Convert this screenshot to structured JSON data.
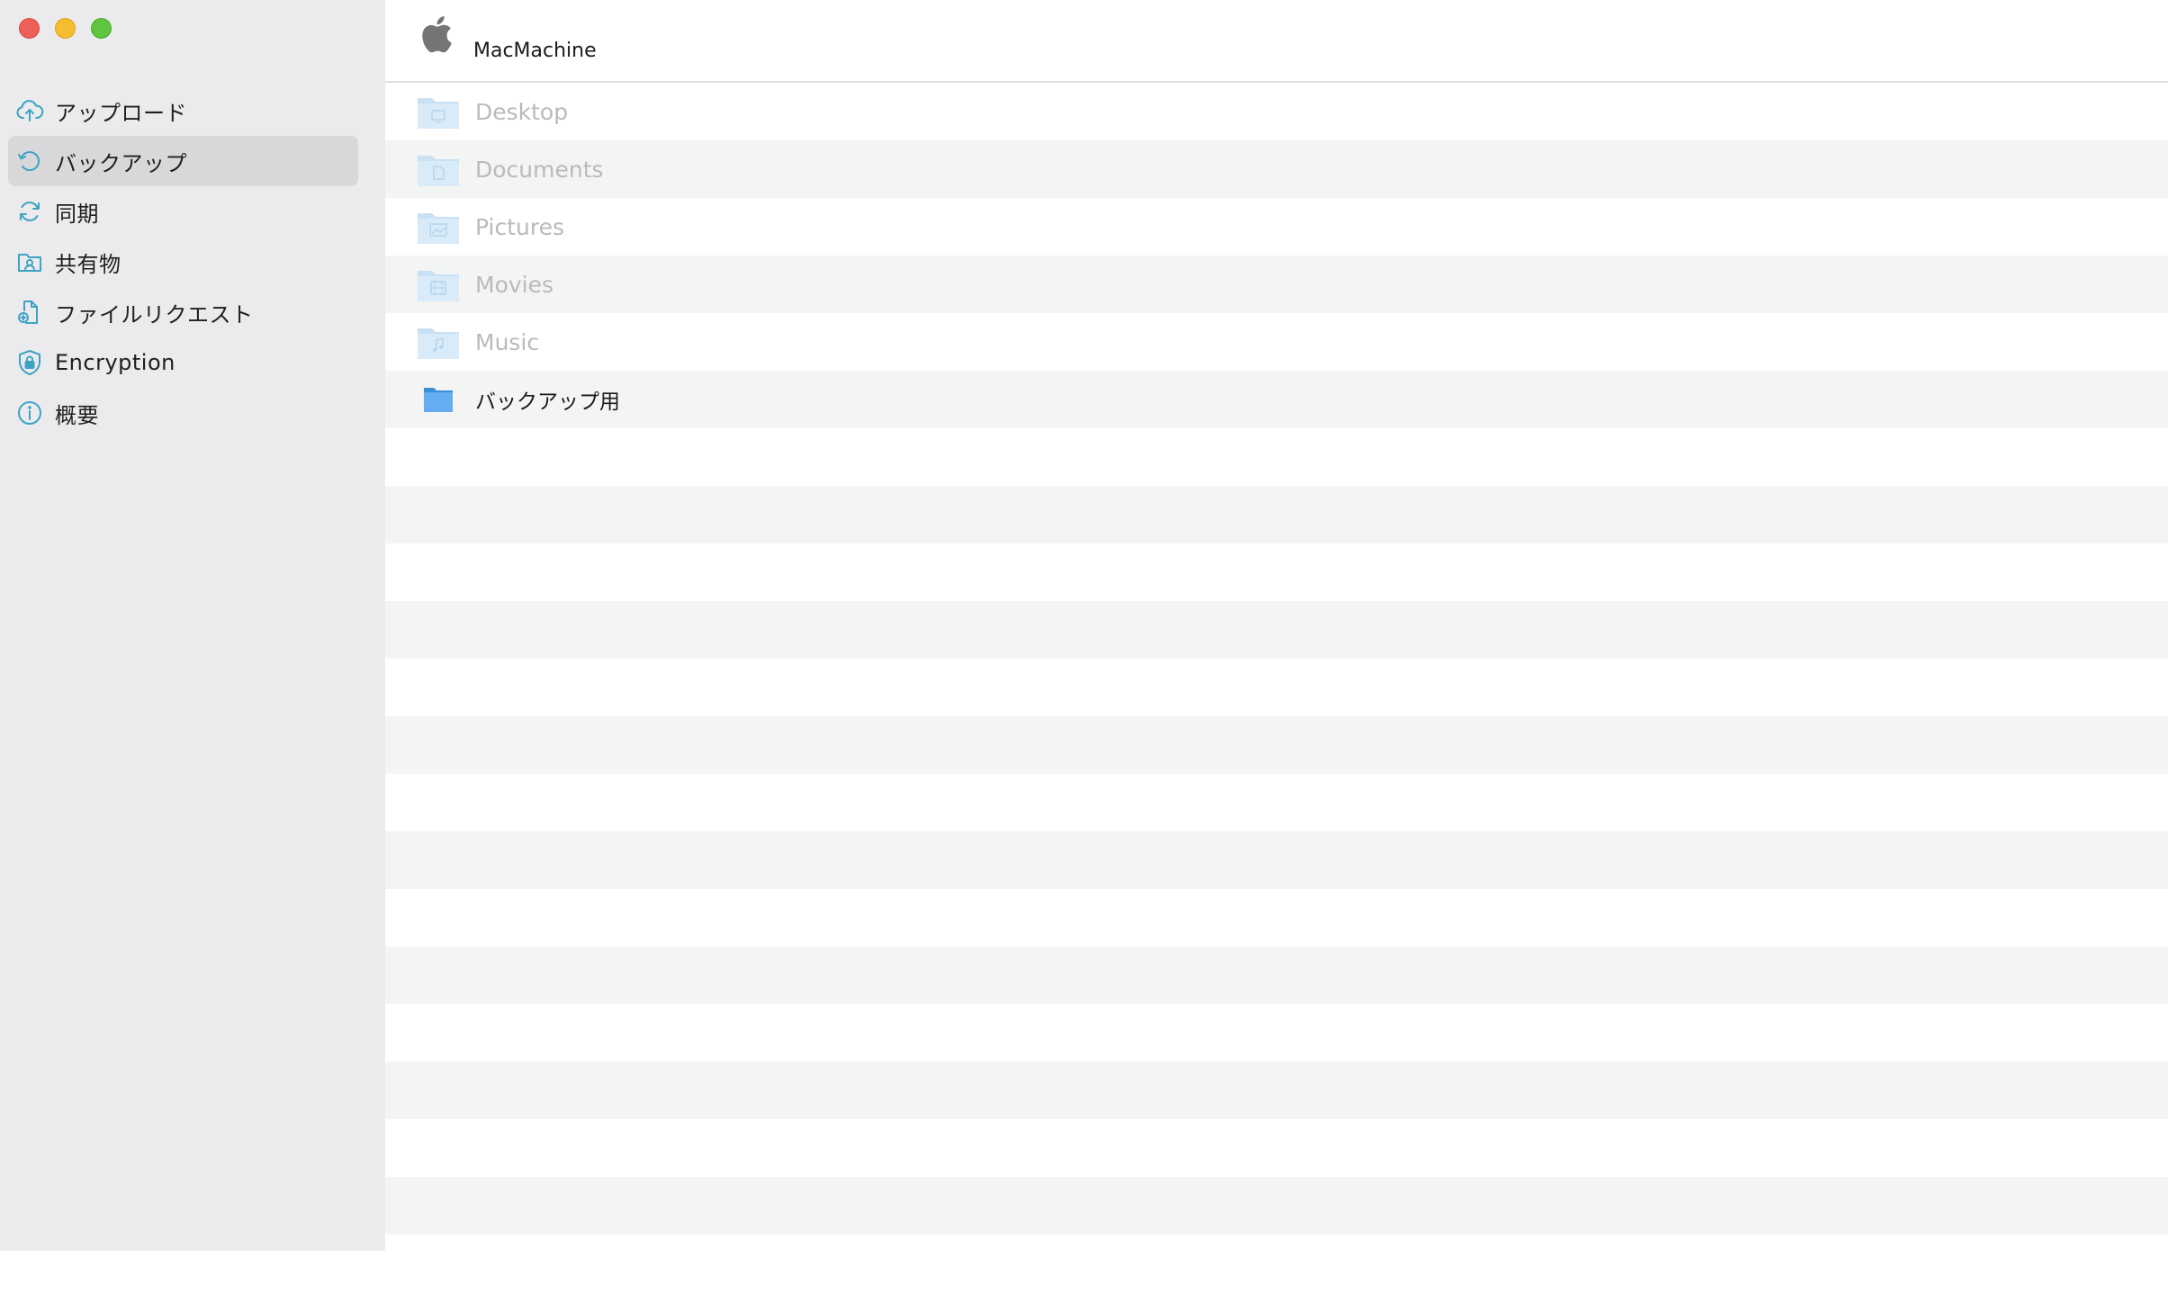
{
  "header": {
    "title": "MacMachine",
    "icon": "apple-logo-icon"
  },
  "sidebar": {
    "items": [
      {
        "label": "アップロード",
        "icon": "cloud-upload-icon",
        "selected": false
      },
      {
        "label": "バックアップ",
        "icon": "backup-history-icon",
        "selected": true
      },
      {
        "label": "同期",
        "icon": "sync-icon",
        "selected": false
      },
      {
        "label": "共有物",
        "icon": "shared-folder-icon",
        "selected": false
      },
      {
        "label": "ファイルリクエスト",
        "icon": "file-request-icon",
        "selected": false
      },
      {
        "label": "Encryption",
        "icon": "shield-lock-icon",
        "selected": false
      },
      {
        "label": "概要",
        "icon": "info-icon",
        "selected": false
      }
    ]
  },
  "folders": [
    {
      "label": "Desktop",
      "icon": "desktop-folder-icon",
      "enabled": false
    },
    {
      "label": "Documents",
      "icon": "documents-folder-icon",
      "enabled": false
    },
    {
      "label": "Pictures",
      "icon": "pictures-folder-icon",
      "enabled": false
    },
    {
      "label": "Movies",
      "icon": "movies-folder-icon",
      "enabled": false
    },
    {
      "label": "Music",
      "icon": "music-folder-icon",
      "enabled": false
    },
    {
      "label": "バックアップ用",
      "icon": "folder-icon",
      "enabled": true
    }
  ],
  "colors": {
    "accent": "#3ea3c4",
    "sidebar_bg": "#ebebee",
    "selected_bg": "#d8d8db",
    "row_stripe": "#f3f4f4",
    "disabled_text": "#b8babd"
  }
}
